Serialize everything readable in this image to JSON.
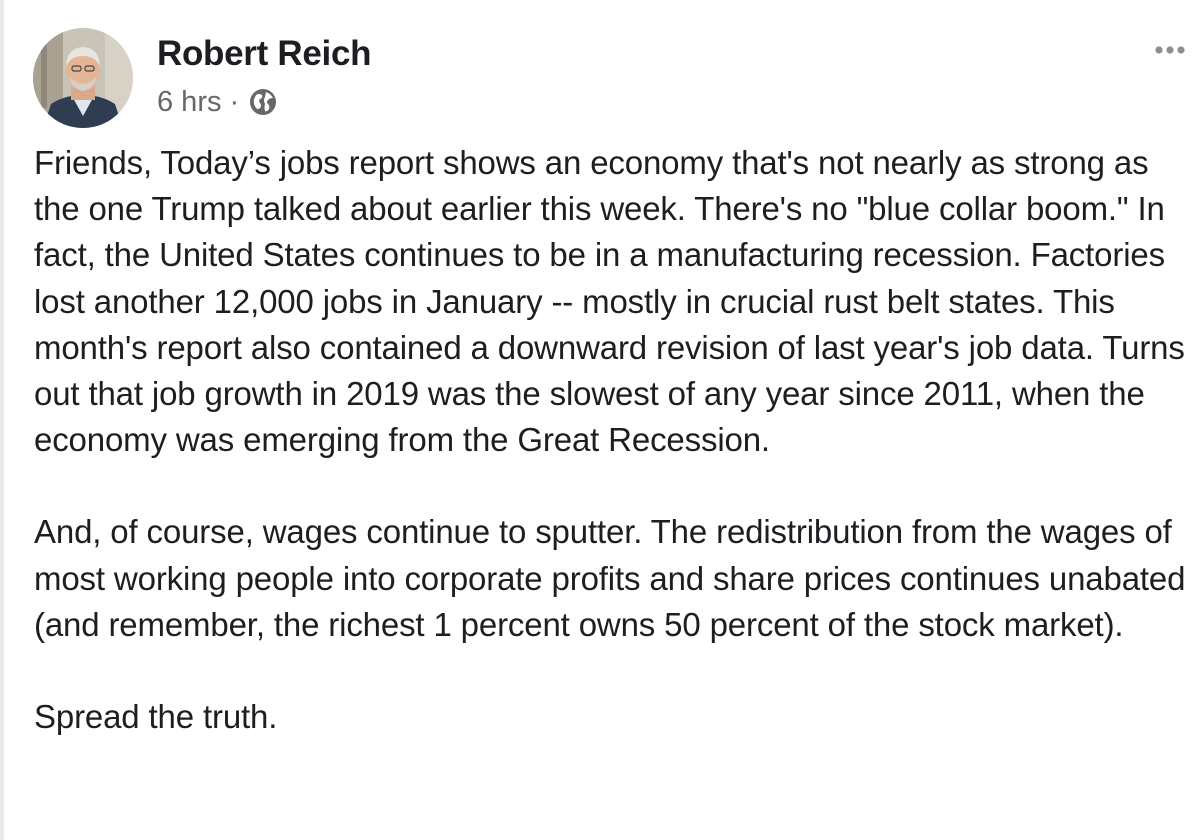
{
  "post": {
    "author": "Robert Reich",
    "timestamp": "6 hrs",
    "separator": "·",
    "privacy_icon": "globe-icon",
    "menu_icon": "more-options-icon",
    "paragraphs": [
      "Friends, Today’s jobs report shows an economy that's not nearly as strong as the one Trump talked about earlier this week. There's no \"blue collar boom.\" In fact, the United States continues to be in a manufacturing recession. Factories lost another 12,000 jobs in January -- mostly in crucial rust belt states. This month's report also contained a downward revision of last year's job data. Turns out that job growth in 2019 was the slowest of any year since 2011, when the economy was emerging from the Great Recession.",
      "And, of course, wages continue to sputter. The redistribution from the wages of most working people into corporate profits and share prices continues unabated (and remember, the richest 1 percent owns 50 percent of the stock market).",
      "Spread the truth."
    ]
  },
  "colors": {
    "text": "#1c1e21",
    "secondary_text": "#65676b",
    "background": "#ffffff"
  }
}
